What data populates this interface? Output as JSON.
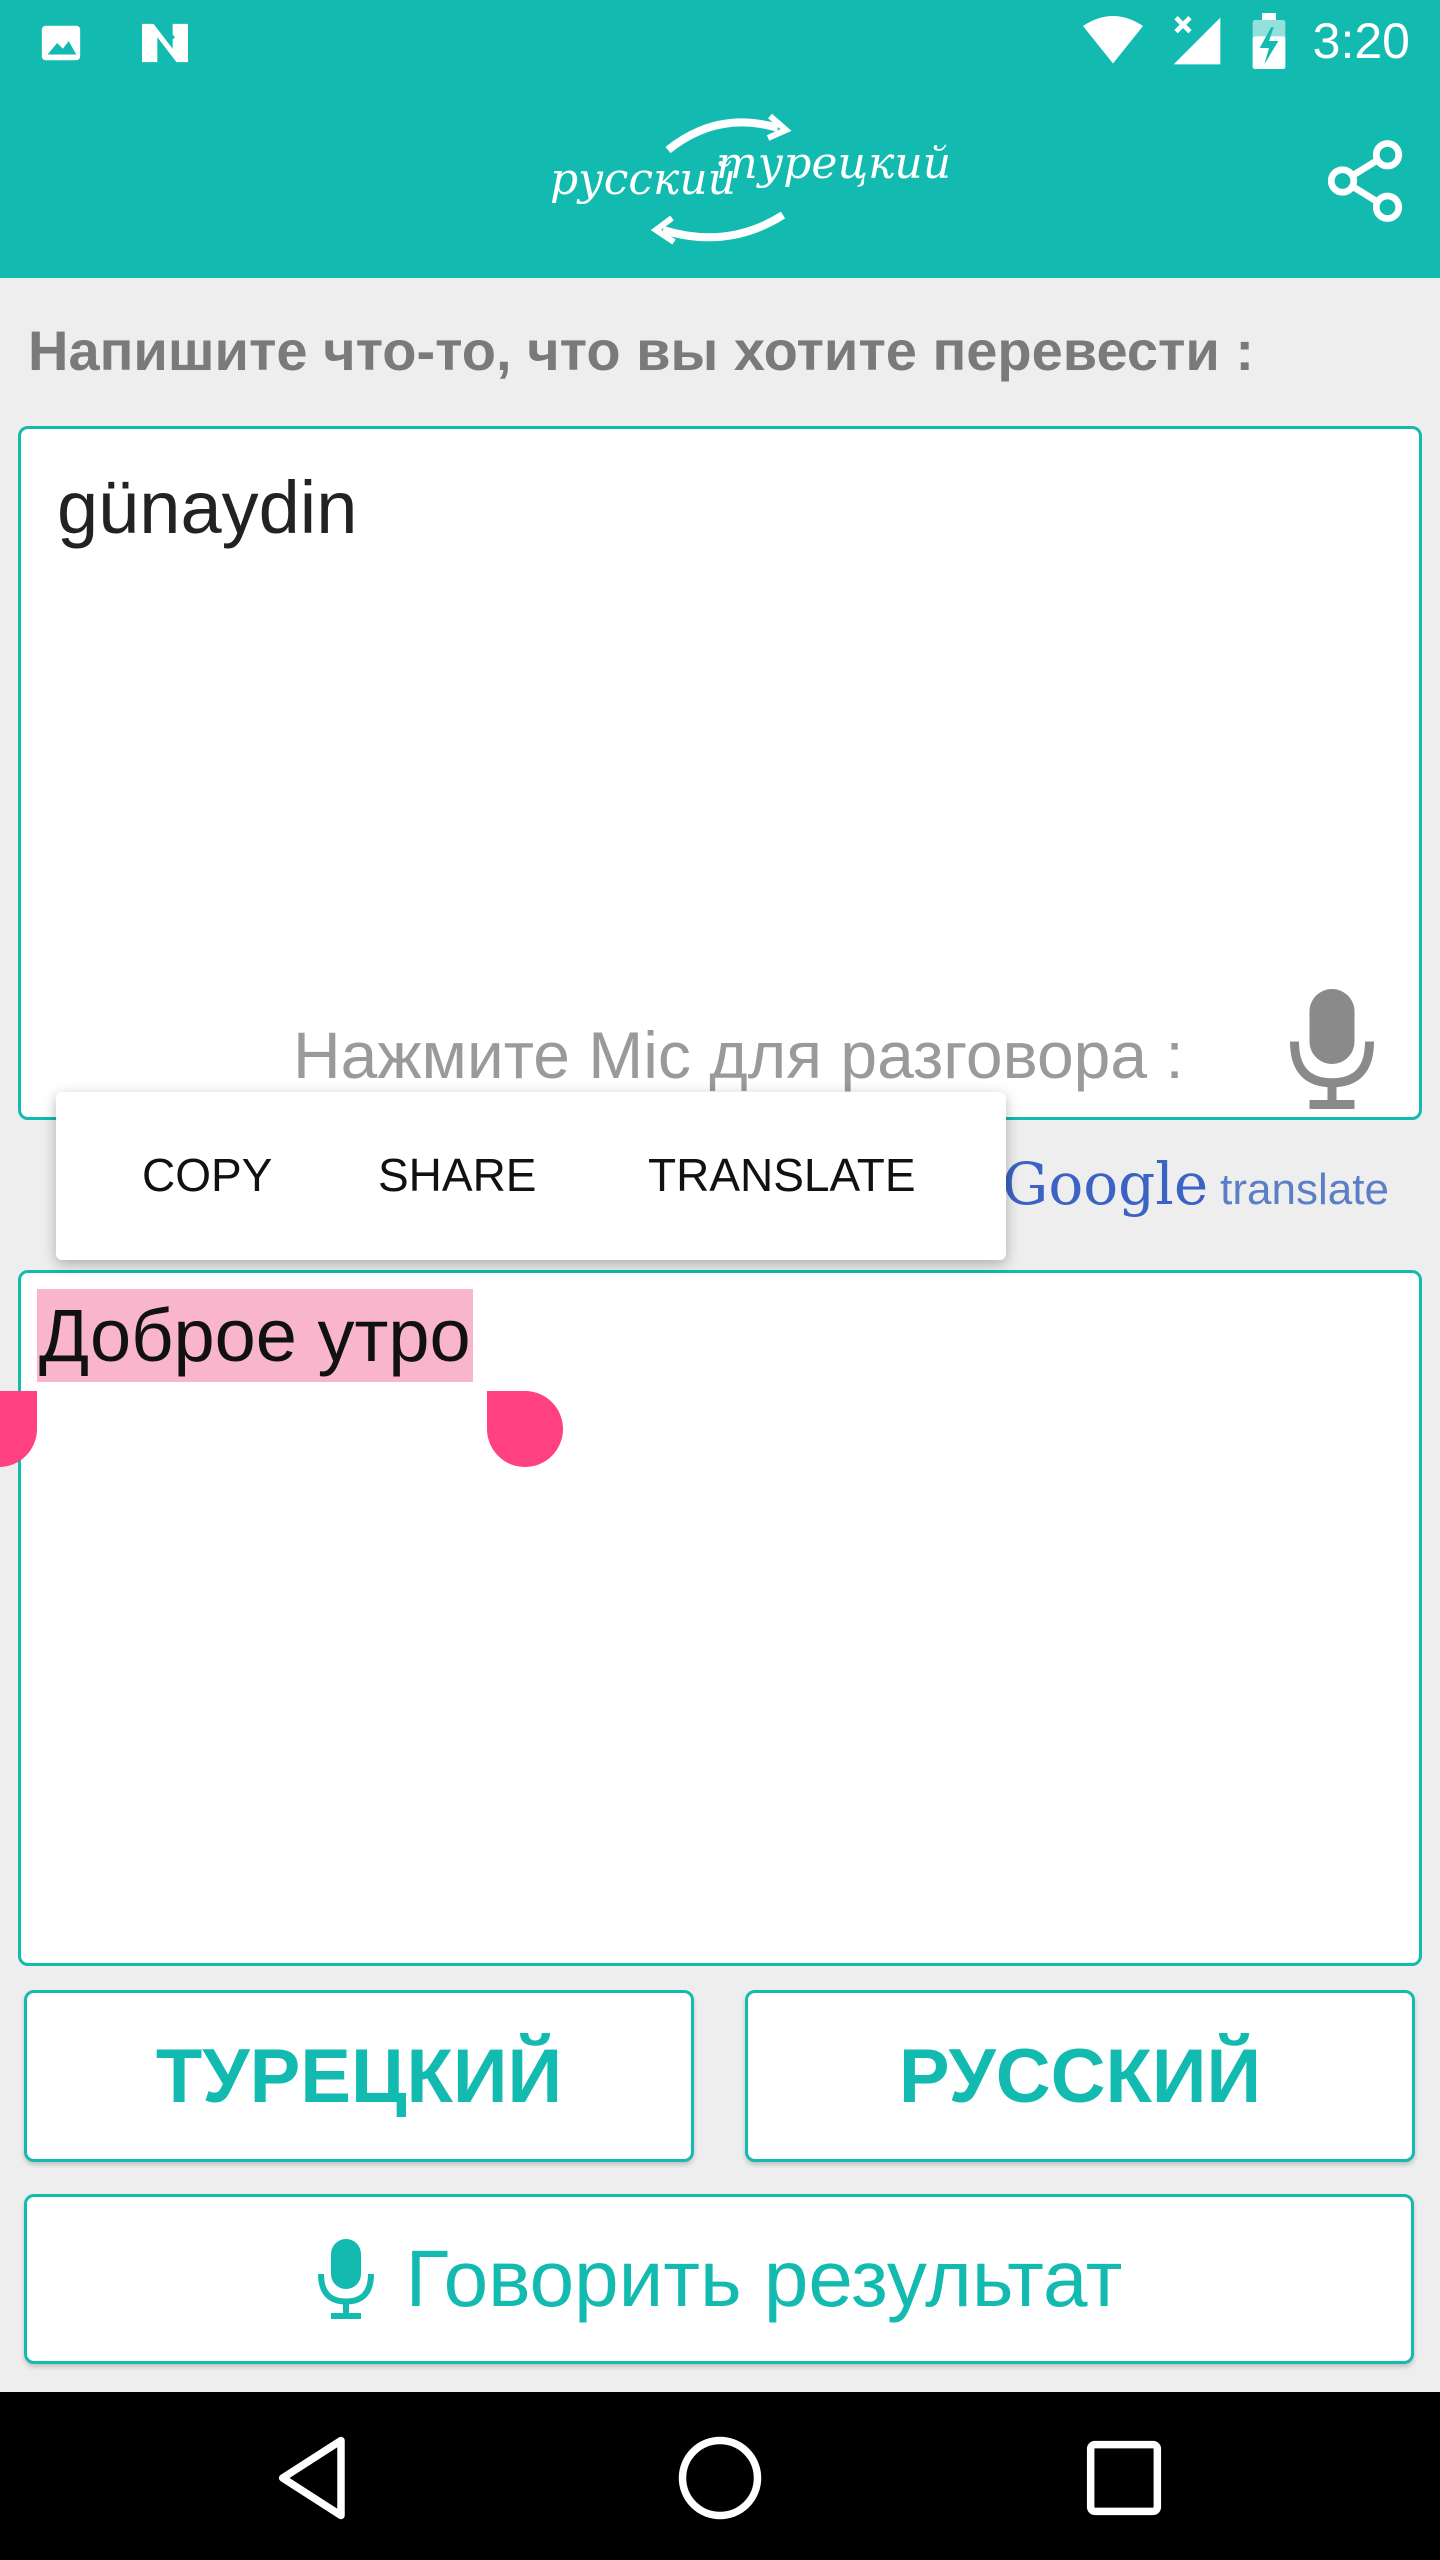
{
  "status_bar": {
    "time": "3:20",
    "icons": [
      "image-icon",
      "n-badge-icon",
      "wifi-icon",
      "signal-icon",
      "battery-charging-icon"
    ]
  },
  "app_bar": {
    "logo_left": "русский",
    "logo_right": "турецкий",
    "share_icon": "share-icon",
    "color": "#12bab0"
  },
  "main": {
    "prompt": "Напишите что-то, что вы хотите перевести :",
    "input_value": "günaydin",
    "mic_hint": "Нажмите Mic для разговора :",
    "google_label": "Google",
    "translate_label": "translate",
    "output_value": "Доброе утро",
    "selection_color": "#f8b5cb",
    "handle_color": "#ff4081"
  },
  "context_menu": {
    "items": [
      "COPY",
      "SHARE",
      "TRANSLATE"
    ]
  },
  "buttons": {
    "turkish": "ТУРЕЦКИЙ",
    "russian": "РУССКИЙ",
    "speak_result": "Говорить результат"
  },
  "nav_bar": {
    "icons": [
      "back-icon",
      "home-icon",
      "recents-icon"
    ]
  }
}
